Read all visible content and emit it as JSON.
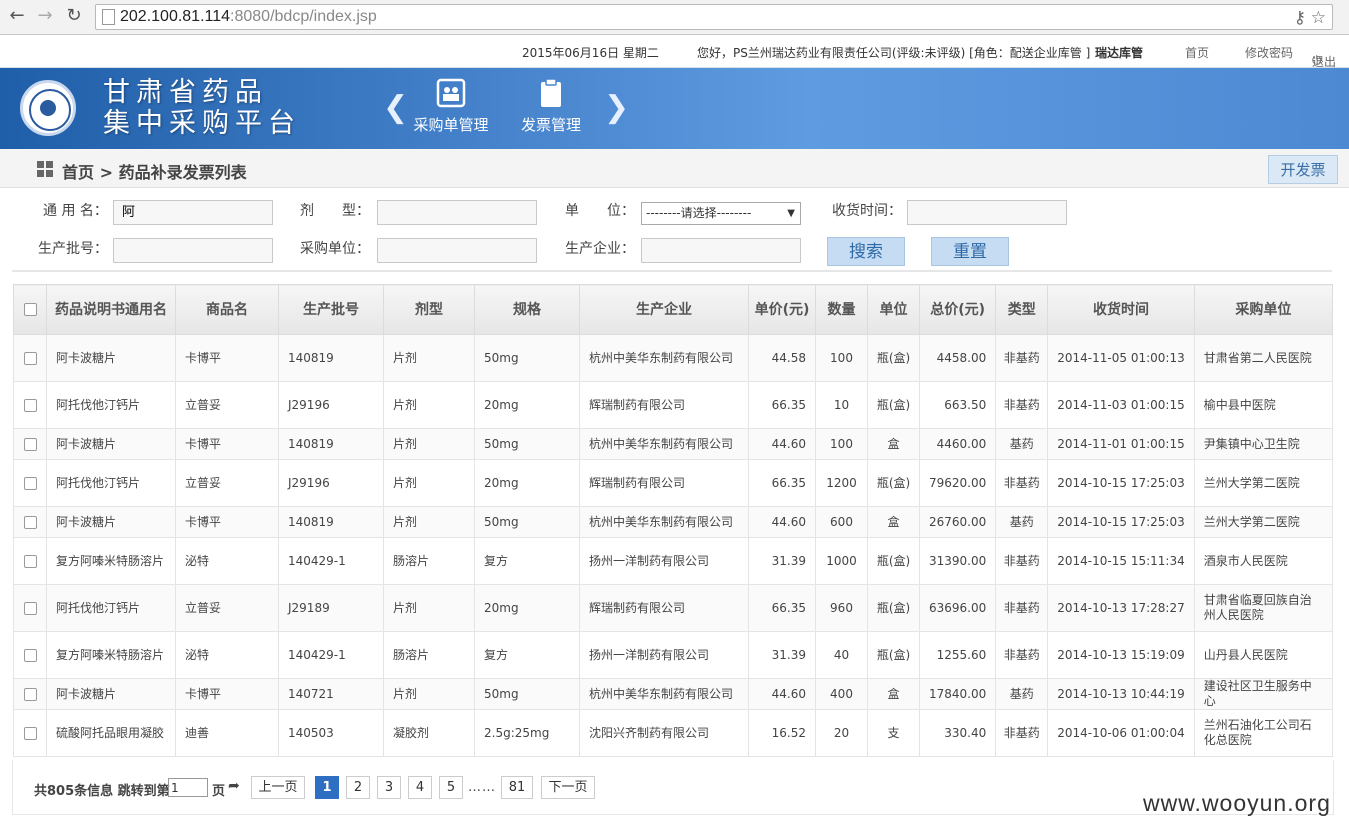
{
  "browser": {
    "url_host": "202.100.81.114",
    "url_rest": ":8080/bdcp/index.jsp"
  },
  "infobar": {
    "date": "2015年06月16日 星期二",
    "greeting": "您好，PS兰州瑞达药业有限责任公司(评级:未评级) [角色：配送企业库管 ]",
    "user": "瑞达库管",
    "home": "首页",
    "change_password": "修改密码",
    "logout": "退出"
  },
  "banner": {
    "title_line1": "甘肃省药品",
    "title_line2": "集中采购平台",
    "menu": [
      {
        "label": "采购单管理"
      },
      {
        "label": "发票管理"
      }
    ]
  },
  "breadcrumb": {
    "home": "首页",
    "sep": ">",
    "current": "药品补录发票列表",
    "action_button": "开发票"
  },
  "search_form": {
    "generic_name_label": "通 用 名：",
    "generic_name_value": "阿",
    "dosage_label": "剂　　型：",
    "unit_label": "单　　位：",
    "unit_selected": "--------请选择--------",
    "receive_time_label": "收货时间：",
    "batch_label": "生产批号：",
    "purchaser_label": "采购单位：",
    "manufacturer_label": "生产企业：",
    "search_button": "搜索",
    "reset_button": "重置"
  },
  "table": {
    "columns": [
      "药品说明书通用名",
      "商品名",
      "生产批号",
      "剂型",
      "规格",
      "生产企业",
      "单价(元)",
      "数量",
      "单位",
      "总价(元)",
      "类型",
      "收货时间",
      "采购单位"
    ],
    "rows": [
      {
        "generic": "阿卡波糖片",
        "brand": "卡博平",
        "batch": "140819",
        "form": "片剂",
        "spec": "50mg",
        "maker": "杭州中美华东制药有限公司",
        "price": "44.58",
        "qty": "100",
        "unit": "瓶(盒)",
        "total": "4458.00",
        "type": "非基药",
        "time": "2014-11-05 01:00:13",
        "buyer": "甘肃省第二人民医院"
      },
      {
        "generic": "阿托伐他汀钙片",
        "brand": "立普妥",
        "batch": "J29196",
        "form": "片剂",
        "spec": "20mg",
        "maker": "辉瑞制药有限公司",
        "price": "66.35",
        "qty": "10",
        "unit": "瓶(盒)",
        "total": "663.50",
        "type": "非基药",
        "time": "2014-11-03 01:00:15",
        "buyer": "榆中县中医院"
      },
      {
        "generic": "阿卡波糖片",
        "brand": "卡博平",
        "batch": "140819",
        "form": "片剂",
        "spec": "50mg",
        "maker": "杭州中美华东制药有限公司",
        "price": "44.60",
        "qty": "100",
        "unit": "盒",
        "total": "4460.00",
        "type": "基药",
        "time": "2014-11-01 01:00:15",
        "buyer": "尹集镇中心卫生院"
      },
      {
        "generic": "阿托伐他汀钙片",
        "brand": "立普妥",
        "batch": "J29196",
        "form": "片剂",
        "spec": "20mg",
        "maker": "辉瑞制药有限公司",
        "price": "66.35",
        "qty": "1200",
        "unit": "瓶(盒)",
        "total": "79620.00",
        "type": "非基药",
        "time": "2014-10-15 17:25:03",
        "buyer": "兰州大学第二医院"
      },
      {
        "generic": "阿卡波糖片",
        "brand": "卡博平",
        "batch": "140819",
        "form": "片剂",
        "spec": "50mg",
        "maker": "杭州中美华东制药有限公司",
        "price": "44.60",
        "qty": "600",
        "unit": "盒",
        "total": "26760.00",
        "type": "基药",
        "time": "2014-10-15 17:25:03",
        "buyer": "兰州大学第二医院"
      },
      {
        "generic": "复方阿嗪米特肠溶片",
        "brand": "泌特",
        "batch": "140429-1",
        "form": "肠溶片",
        "spec": "复方",
        "maker": "扬州一洋制药有限公司",
        "price": "31.39",
        "qty": "1000",
        "unit": "瓶(盒)",
        "total": "31390.00",
        "type": "非基药",
        "time": "2014-10-15 15:11:34",
        "buyer": "酒泉市人民医院"
      },
      {
        "generic": "阿托伐他汀钙片",
        "brand": "立普妥",
        "batch": "J29189",
        "form": "片剂",
        "spec": "20mg",
        "maker": "辉瑞制药有限公司",
        "price": "66.35",
        "qty": "960",
        "unit": "瓶(盒)",
        "total": "63696.00",
        "type": "非基药",
        "time": "2014-10-13 17:28:27",
        "buyer": "甘肃省临夏回族自治州人民医院"
      },
      {
        "generic": "复方阿嗪米特肠溶片",
        "brand": "泌特",
        "batch": "140429-1",
        "form": "肠溶片",
        "spec": "复方",
        "maker": "扬州一洋制药有限公司",
        "price": "31.39",
        "qty": "40",
        "unit": "瓶(盒)",
        "total": "1255.60",
        "type": "非基药",
        "time": "2014-10-13 15:19:09",
        "buyer": "山丹县人民医院"
      },
      {
        "generic": "阿卡波糖片",
        "brand": "卡博平",
        "batch": "140721",
        "form": "片剂",
        "spec": "50mg",
        "maker": "杭州中美华东制药有限公司",
        "price": "44.60",
        "qty": "400",
        "unit": "盒",
        "total": "17840.00",
        "type": "基药",
        "time": "2014-10-13 10:44:19",
        "buyer": "建设社区卫生服务中心"
      },
      {
        "generic": "硫酸阿托品眼用凝胶",
        "brand": "迪善",
        "batch": "140503",
        "form": "凝胶剂",
        "spec": "2.5g:25mg",
        "maker": "沈阳兴齐制药有限公司",
        "price": "16.52",
        "qty": "20",
        "unit": "支",
        "total": "330.40",
        "type": "非基药",
        "time": "2014-10-06 01:00:04",
        "buyer": "兰州石油化工公司石化总医院"
      }
    ]
  },
  "pager": {
    "info": "共805条信息 跳转到第",
    "page_value": "1",
    "suffix": "页",
    "prev": "上一页",
    "pages": [
      "1",
      "2",
      "3",
      "4",
      "5"
    ],
    "ellipsis": "……",
    "last": "81",
    "next": "下一页"
  },
  "watermark": "www.wooyun.org"
}
